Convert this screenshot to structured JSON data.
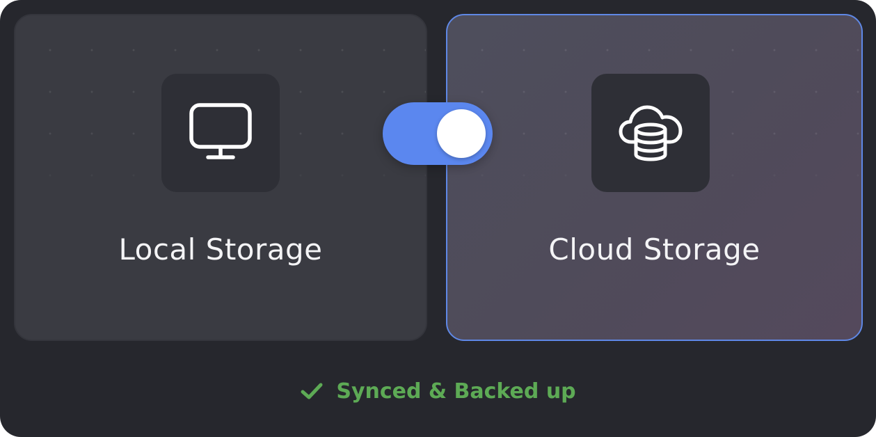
{
  "cards": {
    "local": {
      "label": "Local Storage",
      "icon": "monitor-icon",
      "selected": false
    },
    "cloud": {
      "label": "Cloud Storage",
      "icon": "cloud-database-icon",
      "selected": true
    }
  },
  "toggle": {
    "state": "on",
    "icon": "toggle-switch"
  },
  "status": {
    "text": "Synced & Backed up",
    "icon": "checkmark-icon"
  },
  "colors": {
    "background": "#26272d",
    "accent": "#5b87ef",
    "status_green": "#5daa55",
    "text": "#f4f4f6"
  }
}
